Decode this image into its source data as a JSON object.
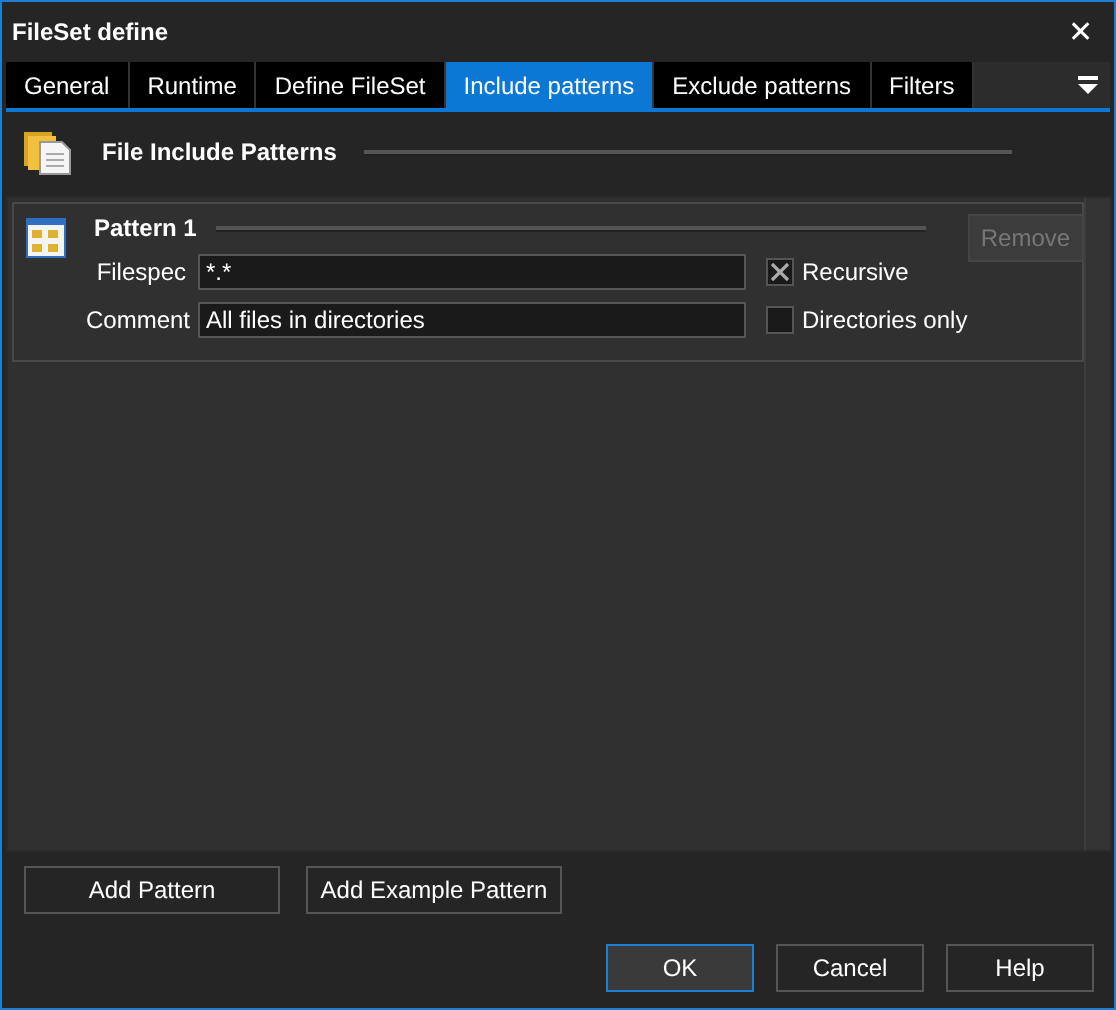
{
  "window": {
    "title": "FileSet define",
    "close": "✕"
  },
  "tabs": [
    {
      "label": "General",
      "selected": false
    },
    {
      "label": "Runtime",
      "selected": false
    },
    {
      "label": "Define FileSet",
      "selected": false
    },
    {
      "label": "Include patterns",
      "selected": true
    },
    {
      "label": "Exclude patterns",
      "selected": false
    },
    {
      "label": "Filters",
      "selected": false
    }
  ],
  "section": {
    "title": "File Include Patterns"
  },
  "patterns": [
    {
      "title": "Pattern 1",
      "remove": {
        "label": "Remove",
        "disabled": true
      },
      "filespec_label": "Filespec",
      "filespec": "*.*",
      "comment_label": "Comment",
      "comment": "All files in directories",
      "recursive": {
        "label": "Recursive",
        "checked": true
      },
      "directories_only": {
        "label": "Directories only",
        "checked": false
      }
    }
  ],
  "actions": [
    {
      "label": "Add Pattern"
    },
    {
      "label": "Add Example Pattern"
    }
  ],
  "buttons": [
    {
      "label": "OK",
      "default": true
    },
    {
      "label": "Cancel",
      "default": false
    },
    {
      "label": "Help",
      "default": false
    }
  ]
}
